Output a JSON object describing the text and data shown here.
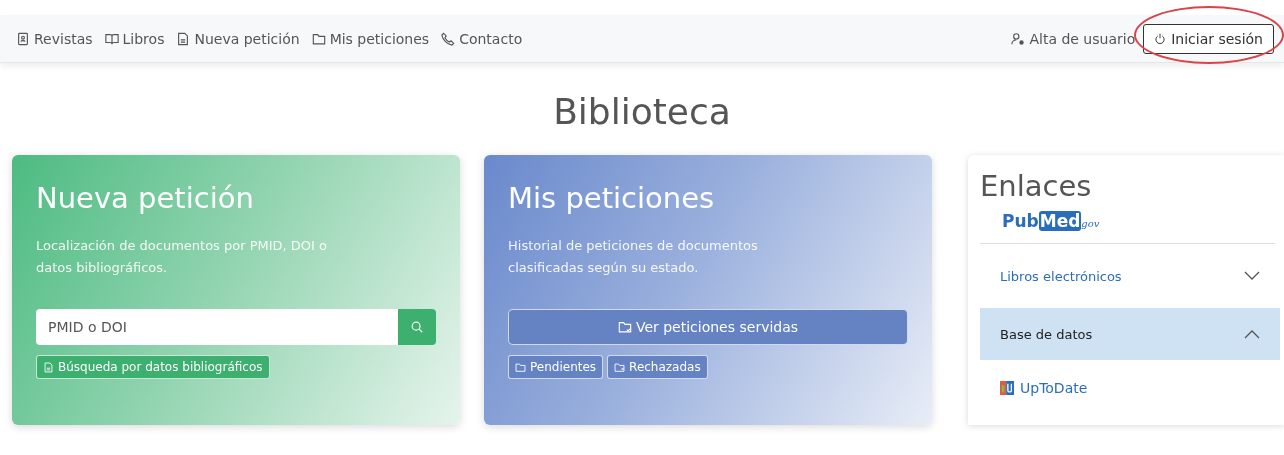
{
  "navbar": {
    "links": [
      {
        "label": "Revistas",
        "kind": "contacts"
      },
      {
        "label": "Libros",
        "kind": "book"
      },
      {
        "label": "Nueva petición",
        "kind": "document"
      },
      {
        "label": "Mis peticiones",
        "kind": "folder"
      },
      {
        "label": "Contacto",
        "kind": "phone"
      }
    ],
    "right": [
      {
        "label": "Alta de usuario",
        "kind": "link",
        "highlighted": false
      },
      {
        "label": "Iniciar sesión",
        "kind": "button",
        "highlighted": true
      }
    ]
  },
  "page_title": "Biblioteca",
  "cards": [
    {
      "kind": "search",
      "title": "Nueva petición",
      "description": "Localización de documentos por PMID, DOI o datos bibliográficos.",
      "placeholder": "PMID o DOI",
      "buttons": [
        {
          "label": "Búsqueda por datos bibliográficos",
          "kind": "document"
        }
      ]
    },
    {
      "kind": "requests",
      "title": "Mis peticiones",
      "description": "Historial de peticiones de documentos clasificadas según su estado.",
      "main_button": {
        "label": "Ver peticiones servidas",
        "kind": "folder-check"
      },
      "buttons": [
        {
          "label": "Pendientes",
          "kind": "folder"
        },
        {
          "label": "Rechazadas",
          "kind": "folder-x"
        }
      ]
    }
  ],
  "links_panel": {
    "title": "Enlaces",
    "logo": {
      "part_1": "Pub",
      "part_2": "Med",
      "suffix": "gov"
    },
    "sections": [
      {
        "label": "Libros electrónicos",
        "expanded": false
      },
      {
        "label": "Base de datos",
        "expanded": true,
        "items": [
          {
            "label": "UpToDate"
          }
        ]
      }
    ]
  }
}
